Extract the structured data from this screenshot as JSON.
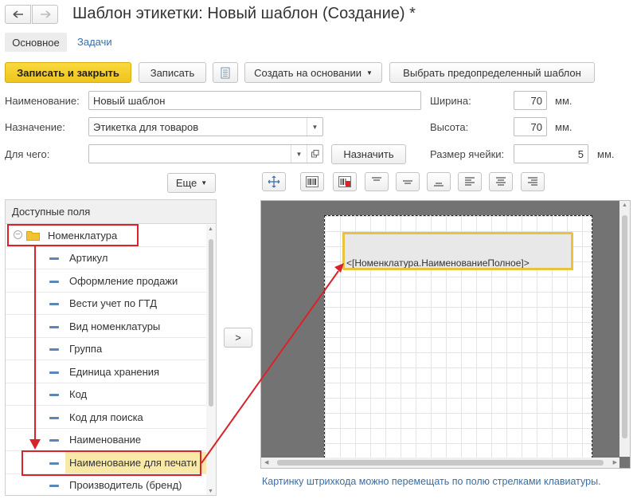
{
  "window": {
    "title": "Шаблон этикетки: Новый шаблон (Создание) *"
  },
  "tabs": [
    {
      "label": "Основное",
      "active": true
    },
    {
      "label": "Задачи",
      "active": false
    }
  ],
  "toolbar": {
    "save_close": "Записать и закрыть",
    "save": "Записать",
    "create_based": "Создать на основании",
    "choose_template": "Выбрать предопределенный шаблон"
  },
  "form": {
    "name_label": "Наименование:",
    "name_value": "Новый шаблон",
    "purpose_label": "Назначение:",
    "purpose_value": "Этикетка для товаров",
    "for_what_label": "Для чего:",
    "for_what_value": "",
    "assign_button": "Назначить",
    "width_label": "Ширина:",
    "width_value": "70",
    "width_unit": "мм.",
    "height_label": "Высота:",
    "height_value": "70",
    "height_unit": "мм.",
    "cell_label": "Размер ячейки:",
    "cell_value": "5",
    "cell_unit": "мм."
  },
  "fields_panel": {
    "more_button": "Еще",
    "header": "Доступные поля",
    "root": "Номенклатура",
    "items": [
      "Артикул",
      "Оформление продажи",
      "Вести учет по ГТД",
      "Вид номенклатуры",
      "Группа",
      "Единица хранения",
      "Код",
      "Код для поиска",
      "Наименование",
      "Наименование для печати",
      "Производитель (бренд)"
    ],
    "selected_index": 9
  },
  "move_button": ">",
  "canvas": {
    "field_text": "<[Номенклатура.НаименованиеПолное]>",
    "hint": "Картинку штрихкода можно перемещать по полю стрелками клавиатуры."
  },
  "colors": {
    "primary_button": "#f5d02a",
    "highlight_border": "#e8c240",
    "annotation": "#d9232a",
    "selected_row": "#f8e9a7"
  }
}
